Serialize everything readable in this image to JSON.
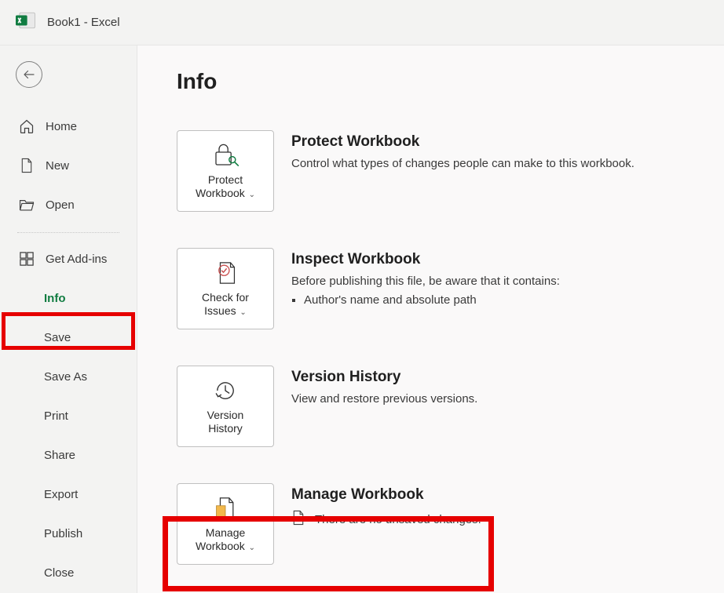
{
  "titlebar": {
    "text": "Book1  -  Excel"
  },
  "sidebar": {
    "home": "Home",
    "new": "New",
    "open": "Open",
    "addins": "Get Add-ins",
    "info": "Info",
    "save": "Save",
    "saveas": "Save As",
    "print": "Print",
    "share": "Share",
    "export": "Export",
    "publish": "Publish",
    "close": "Close"
  },
  "page": {
    "title": "Info"
  },
  "protect": {
    "tile_line1": "Protect",
    "tile_line2": "Workbook",
    "title": "Protect Workbook",
    "desc": "Control what types of changes people can make to this workbook."
  },
  "inspect": {
    "tile_line1": "Check for",
    "tile_line2": "Issues",
    "title": "Inspect Workbook",
    "desc": "Before publishing this file, be aware that it contains:",
    "bullet1": "Author's name and absolute path"
  },
  "version": {
    "tile_line1": "Version",
    "tile_line2": "History",
    "title": "Version History",
    "desc": "View and restore previous versions."
  },
  "manage": {
    "tile_line1": "Manage",
    "tile_line2": "Workbook",
    "title": "Manage Workbook",
    "status": "There are no unsaved changes."
  }
}
